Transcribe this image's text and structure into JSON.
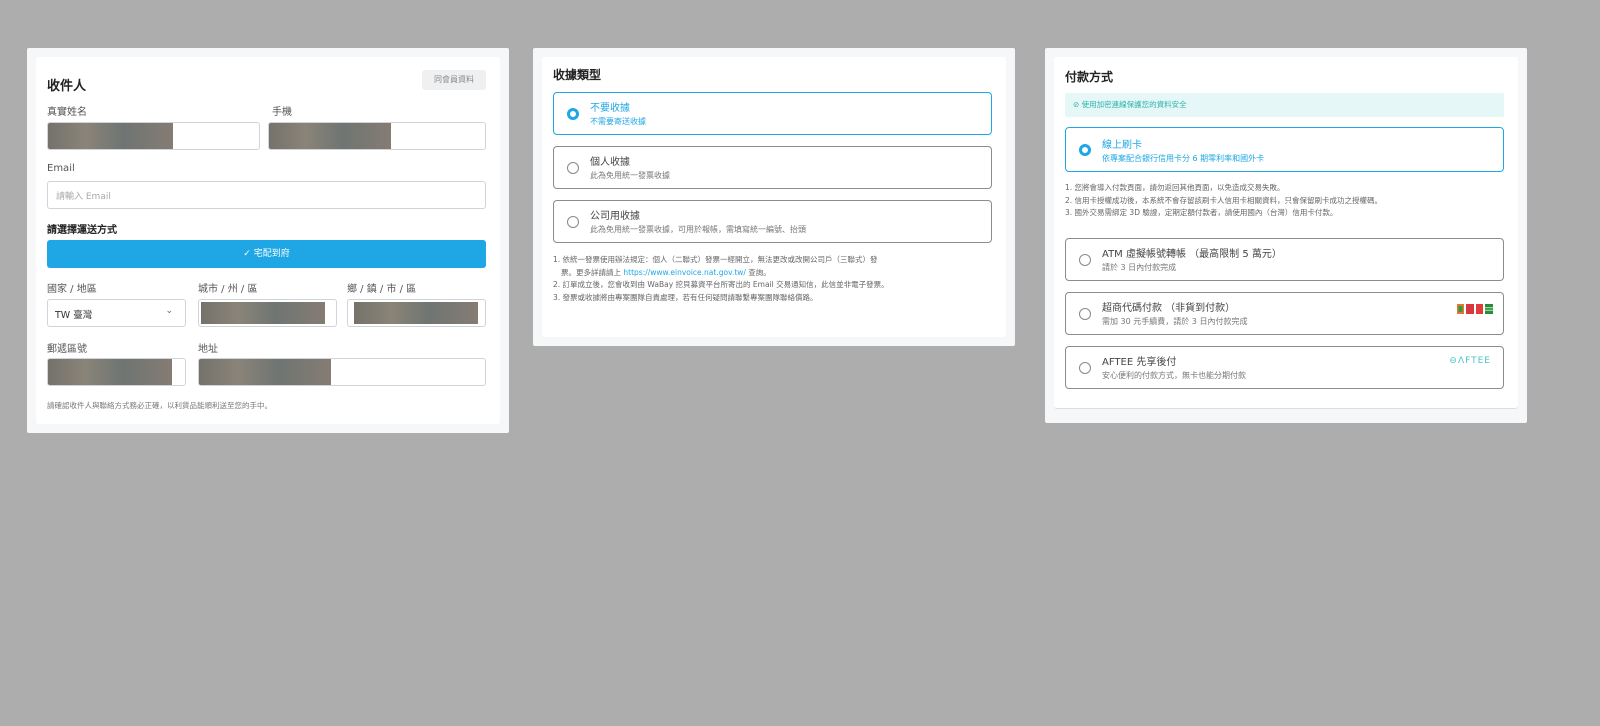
{
  "recipient": {
    "title": "收件人",
    "member_badge": "同會員資料",
    "name_label": "真實姓名",
    "phone_label": "手機",
    "email_label": "Email",
    "email_placeholder": "請輸入 Email",
    "delivery_label": "請選擇運送方式",
    "delivery_button": "✓ 宅配到府",
    "country_label": "國家 / 地區",
    "country_value": "TW 臺灣",
    "city_label": "城市 / 州 / 區",
    "district_label": "鄉 / 鎮 / 市 / 區",
    "zip_label": "郵遞區號",
    "address_label": "地址",
    "footnote": "請確認收件人與聯絡方式務必正確，以利貨品能順利送至您的手中。"
  },
  "receipt": {
    "title": "收據類型",
    "options": [
      {
        "title": "不要收據",
        "subtitle": "不需要寄送收據",
        "selected": true
      },
      {
        "title": "個人收據",
        "subtitle": "此為免用統一發票收據",
        "selected": false
      },
      {
        "title": "公司用收據",
        "subtitle": "此為免用統一發票收據，可用於報帳，需填寫統一編號、抬頭",
        "selected": false
      }
    ],
    "notes": {
      "n1a": "1. 依統一發票使用辦法規定：個人（二聯式）發票一經開立，無法更改或改開公司戶（三聯式）發",
      "n1b": "票。更多詳請請上 ",
      "n1_link": "https://www.einvoice.nat.gov.tw/",
      "n1c": " 查詢。",
      "n2": "2. 訂單成立後，您會收到由 WaBay 挖貝募資平台所寄出的 Email 交易通知信，此信並非電子發票。",
      "n3": "3. 發票或收據將由專案團隊自責處理，若有任何疑問請聯繫專案團隊聯絡償路。"
    }
  },
  "payment": {
    "title": "付款方式",
    "security_notice": "⊘ 使用加密連線保護您的資料安全",
    "card": {
      "title": "線上刷卡",
      "subtitle": "依專案配合銀行信用卡分 6 期零利率和國外卡"
    },
    "card_notes": [
      "1. 您將會導入付款頁面，請勿返回其他頁面，以免造成交易失敗。",
      "2. 信用卡授權成功後，本系統不會存留該刷卡人信用卡相關資料，只會保留刷卡成功之授權碼。",
      "3. 國外交易需綁定 3D 驗證，定期定額付款者，請使用國內（台灣）信用卡付款。"
    ],
    "atm": {
      "title": "ATM 虛擬帳號轉帳 （最高限制 5 萬元）",
      "subtitle": "請於 3 日內付款完成"
    },
    "cvs": {
      "title": "超商代碼付款 （非貨到付款）",
      "subtitle": "需加 30 元手續費，請於 3 日內付款完成"
    },
    "aftee": {
      "title": "AFTEE 先享後付",
      "subtitle": "安心便利的付款方式，無卡也能分期付款",
      "logo": "⊖ΛFTEE"
    },
    "colors": {
      "accent": "#1ea7e4",
      "notice_bg": "#e6f7f8",
      "notice_text": "#2bb3a6"
    }
  }
}
